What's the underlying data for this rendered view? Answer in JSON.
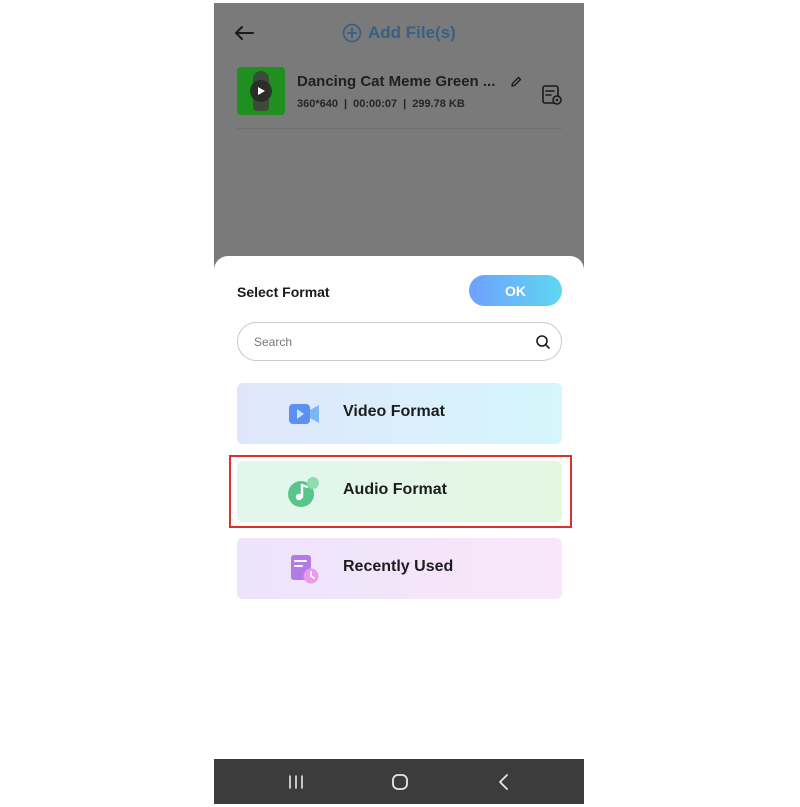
{
  "header": {
    "back_icon": "arrow-left-icon",
    "add_files_label": "Add File(s)",
    "add_icon": "plus-circle-icon"
  },
  "file": {
    "name": "Dancing Cat Meme  Green ...",
    "resolution": "360*640",
    "separator": "|",
    "duration": "00:00:07",
    "size": "299.78 KB"
  },
  "sheet": {
    "title": "Select Format",
    "ok_label": "OK",
    "search_placeholder": "Search",
    "formats": [
      {
        "label": "Video Format",
        "icon": "video-camera-icon"
      },
      {
        "label": "Audio Format",
        "icon": "music-note-icon"
      },
      {
        "label": "Recently Used",
        "icon": "recent-doc-icon"
      }
    ]
  },
  "colors": {
    "accent_start": "#6fa0ff",
    "accent_end": "#5fd7f0",
    "highlight": "#d9312b",
    "link": "#3a5f86"
  },
  "navbar": {
    "icons": [
      "recent-apps-icon",
      "home-icon",
      "back-icon"
    ]
  }
}
